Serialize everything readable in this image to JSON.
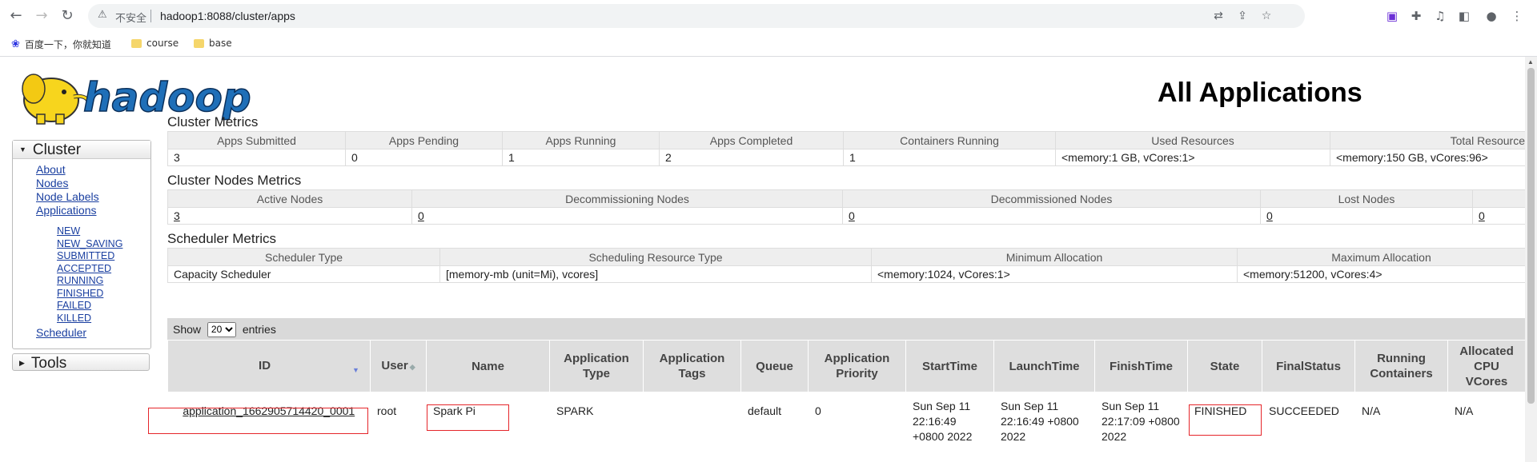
{
  "browser": {
    "insecure_label": "不安全",
    "url": "hadoop1:8088/cluster/apps",
    "bookmarks": [
      {
        "label": "百度一下，你就知道",
        "icon": "baidu-paw-icon"
      },
      {
        "label": "course",
        "icon": "folder-icon"
      },
      {
        "label": "base",
        "icon": "folder-icon"
      }
    ]
  },
  "page": {
    "title": "All Applications"
  },
  "nav": {
    "cluster_label": "Cluster",
    "links": [
      "About",
      "Nodes",
      "Node Labels",
      "Applications"
    ],
    "app_states": [
      "NEW",
      "NEW_SAVING",
      "SUBMITTED",
      "ACCEPTED",
      "RUNNING",
      "FINISHED",
      "FAILED",
      "KILLED"
    ],
    "scheduler_label": "Scheduler",
    "tools_label": "Tools"
  },
  "cluster_metrics": {
    "title": "Cluster Metrics",
    "headers": [
      "Apps Submitted",
      "Apps Pending",
      "Apps Running",
      "Apps Completed",
      "Containers Running",
      "Used Resources",
      "Total Resource"
    ],
    "values": [
      "3",
      "0",
      "1",
      "2",
      "1",
      "<memory:1 GB, vCores:1>",
      "<memory:150 GB, vCores:96>"
    ]
  },
  "nodes_metrics": {
    "title": "Cluster Nodes Metrics",
    "headers": [
      "Active Nodes",
      "Decommissioning Nodes",
      "Decommissioned Nodes",
      "Lost Nodes",
      ""
    ],
    "values": [
      "3",
      "0",
      "0",
      "0",
      "0"
    ]
  },
  "scheduler_metrics": {
    "title": "Scheduler Metrics",
    "headers": [
      "Scheduler Type",
      "Scheduling Resource Type",
      "Minimum Allocation",
      "Maximum Allocation"
    ],
    "values": [
      "Capacity Scheduler",
      "[memory-mb (unit=Mi), vcores]",
      "<memory:1024, vCores:1>",
      "<memory:51200, vCores:4>"
    ]
  },
  "apps_table": {
    "show_label": "Show",
    "page_size": "20",
    "entries_label": "entries",
    "headers": [
      "ID",
      "User",
      "Name",
      "Application Type",
      "Application Tags",
      "Queue",
      "Application Priority",
      "StartTime",
      "LaunchTime",
      "FinishTime",
      "State",
      "FinalStatus",
      "Running Containers",
      "Allocated CPU VCores"
    ],
    "rows": [
      {
        "id": "application_1662905714420_0001",
        "user": "root",
        "name": "Spark Pi",
        "type": "SPARK",
        "tags": "",
        "queue": "default",
        "priority": "0",
        "start": "Sun Sep 11 22:16:49 +0800 2022",
        "launch": "Sun Sep 11 22:16:49 +0800 2022",
        "finish": "Sun Sep 11 22:17:09 +0800 2022",
        "state": "FINISHED",
        "final_status": "SUCCEEDED",
        "running_containers": "N/A",
        "allocated_vcores": "N/A"
      }
    ]
  },
  "colors": {
    "highlight_box": "#e5252a",
    "link": "#1a3fa0",
    "logo_yellow": "#f7d51d",
    "logo_blue": "#1f6fb8"
  }
}
